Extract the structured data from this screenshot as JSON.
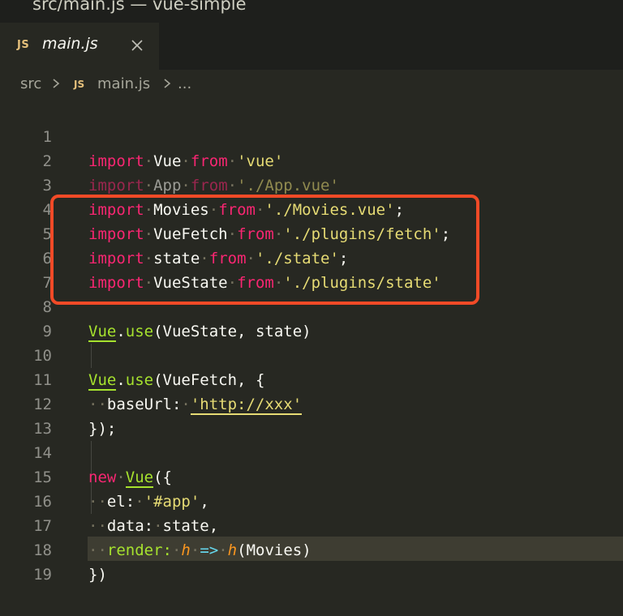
{
  "window": {
    "title": "src/main.js — vue-simple"
  },
  "tab": {
    "badge": "JS",
    "label": "main.js",
    "close_icon": "close-icon"
  },
  "breadcrumb": {
    "folder": "src",
    "badge": "JS",
    "file": "main.js",
    "more": "..."
  },
  "editor": {
    "lines": [
      {
        "n": "1"
      },
      {
        "n": "2"
      },
      {
        "n": "3"
      },
      {
        "n": "4"
      },
      {
        "n": "5"
      },
      {
        "n": "6"
      },
      {
        "n": "7"
      },
      {
        "n": "8"
      },
      {
        "n": "9"
      },
      {
        "n": "10"
      },
      {
        "n": "11"
      },
      {
        "n": "12"
      },
      {
        "n": "13"
      },
      {
        "n": "14"
      },
      {
        "n": "15"
      },
      {
        "n": "16"
      },
      {
        "n": "17"
      },
      {
        "n": "18"
      },
      {
        "n": "19"
      }
    ],
    "tokens": {
      "import": "import",
      "from": "from",
      "vue_id": "Vue",
      "vue_str": "'vue'",
      "app_id": "App",
      "app_str": "'./App.vue'",
      "movies_id": "Movies",
      "movies_str": "'./Movies.vue'",
      "semi": ";",
      "vuefetch_id": "VueFetch",
      "fetch_str": "'./plugins/fetch'",
      "state_id": "state",
      "state_str": "'./state'",
      "vuestate_id": "VueState",
      "pstate_str": "'./plugins/state'",
      "use": "use",
      "dot": ".",
      "use_state_args": "(VueState, state)",
      "use_fetch_open": "(VueFetch, {",
      "baseurl_key": "baseUrl:",
      "baseurl_val": "'http://xxx'",
      "close_paren_semi": "});",
      "new": "new",
      "open_brace": "({",
      "el_key": "el:",
      "el_val": "'#app'",
      "comma": ",",
      "data_key": "data:",
      "data_val": "state,",
      "render_key": "render:",
      "h": "h",
      "arrow": "=>",
      "h_call": "(Movies)",
      "close_all": "})"
    }
  },
  "colors": {
    "keyword": "#f92672",
    "string": "#e6db74",
    "function": "#a6e22e",
    "param": "#fd971f",
    "highlight_box": "#f24a27"
  }
}
